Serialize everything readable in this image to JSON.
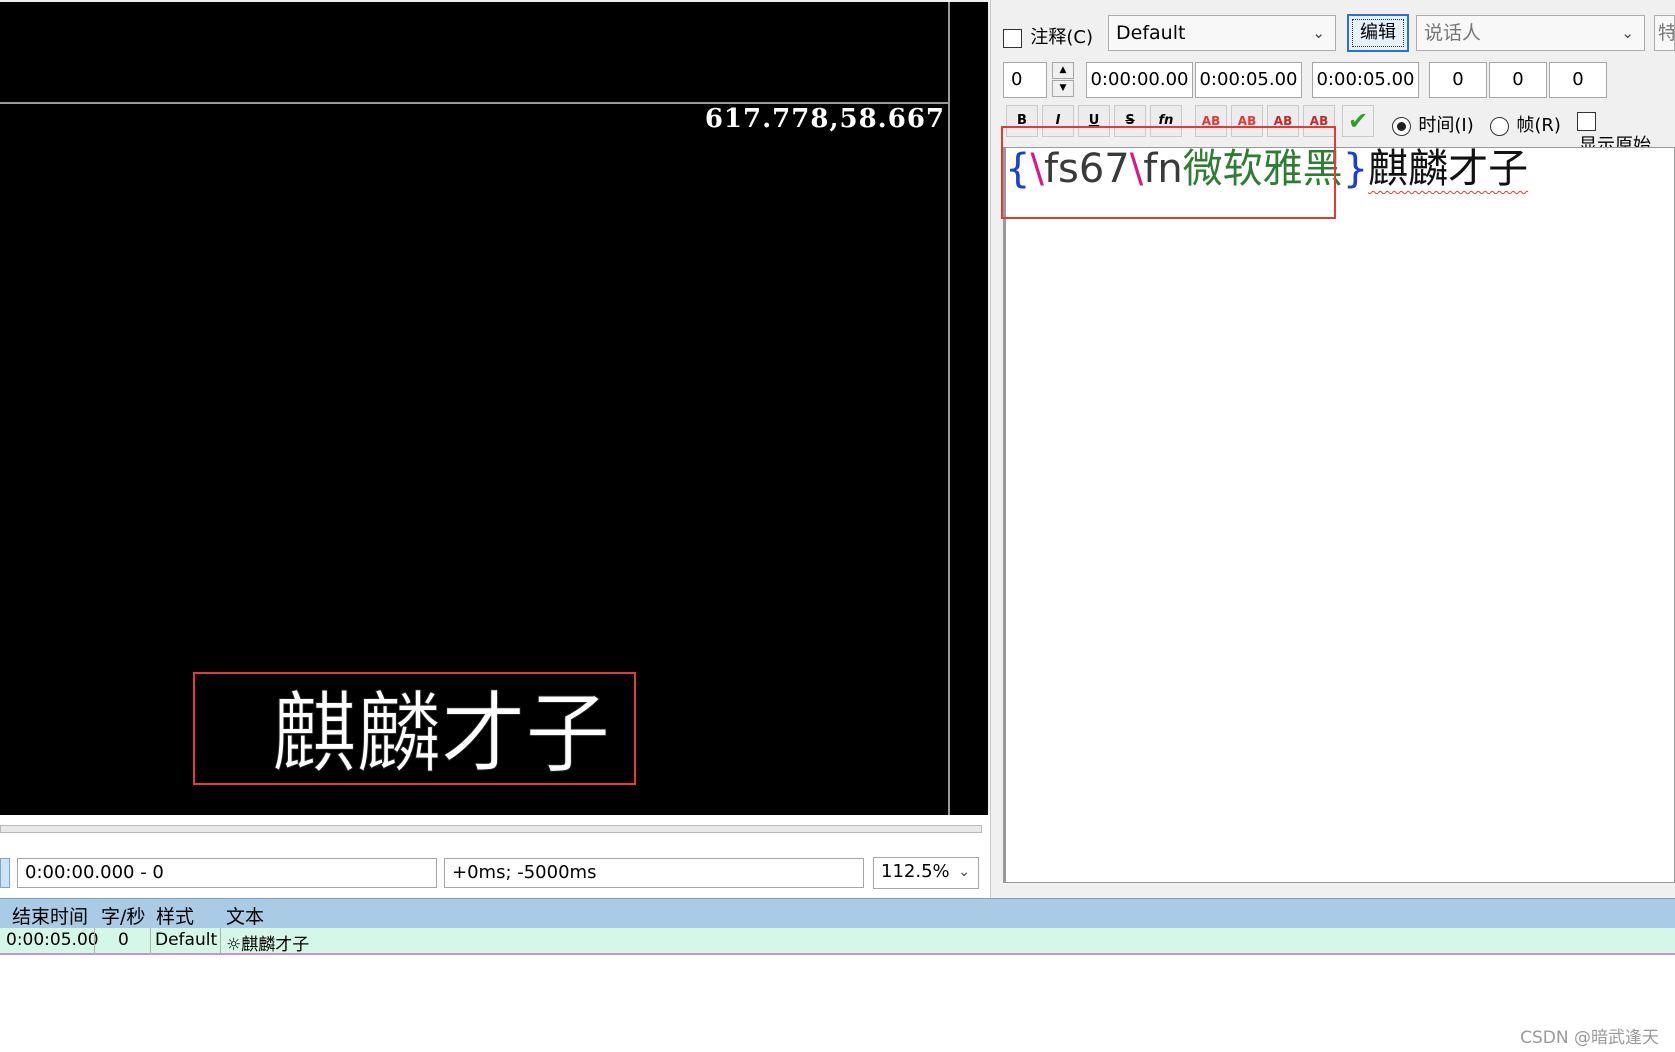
{
  "video": {
    "coord_readout": "617.778,58.667",
    "subtitle_text": "麒麟才子"
  },
  "video_controls": {
    "time_value": "0:00:00.000 - 0",
    "offset_value": "+0ms; -5000ms",
    "zoom_value": "112.5%"
  },
  "editor_toolbar": {
    "comment_label": "注释(C)",
    "style_value": "Default",
    "edit_button_label": "编辑",
    "actor_placeholder": "说话人",
    "effect_label_partial": "特",
    "layer_value": "0",
    "start_time": "0:00:00.00",
    "end_time": "0:00:05.00",
    "duration": "0:00:05.00",
    "margin_left": "0",
    "margin_right": "0",
    "margin_vertical": "0",
    "bold_label": "B",
    "italic_label": "I",
    "underline_label": "U",
    "strike_label": "S",
    "font_label": "fn",
    "color1_label": "AB",
    "color2_label": "AB",
    "color3_label": "AB",
    "color4_label": "AB",
    "commit_icon": "check-icon",
    "time_radio_label": "时间(I)",
    "frame_radio_label": "帧(R)",
    "show_original_label": "显示原始"
  },
  "editor": {
    "brace_open": "{",
    "slash1": "\\",
    "tag1": "fs67",
    "slash2": "\\",
    "tag2_name": "fn",
    "tag2_value": "微软雅黑",
    "brace_close": "}",
    "text": "麒麟才子"
  },
  "grid": {
    "columns": [
      "结束时间",
      "字/秒",
      "样式",
      "文本"
    ],
    "rows": [
      {
        "end_time": "0:00:05.00",
        "cps": "0",
        "style": "Default",
        "text": "☼麒麟才子"
      }
    ]
  },
  "watermark": "CSDN @暗武逢天",
  "colors": {
    "accent": "#2b73c9",
    "highlight_box": "#e53935",
    "grid_header": "#a9cbe6",
    "grid_row": "#d4f7e6"
  }
}
